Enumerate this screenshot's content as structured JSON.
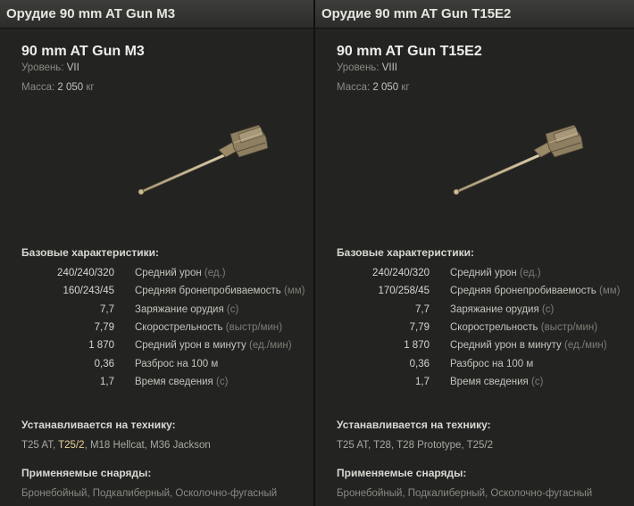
{
  "panels": [
    {
      "header": "Орудие 90 mm AT Gun M3",
      "name": "90 mm AT Gun M3",
      "level_label": "Уровень:",
      "level_value": "VII",
      "mass_label": "Масса:",
      "mass_value": "2 050",
      "mass_unit": "кг",
      "base_title": "Базовые характеристики:",
      "stats": [
        {
          "value": "240/240/320",
          "label": "Средний урон",
          "unit": "(ед.)"
        },
        {
          "value": "160/243/45",
          "label": "Средняя бронепробиваемость",
          "unit": "(мм)"
        },
        {
          "value": "7,7",
          "label": "Заряжание орудия",
          "unit": "(с)"
        },
        {
          "value": "7,79",
          "label": "Скорострельность",
          "unit": "(выстр/мин)"
        },
        {
          "value": "1 870",
          "label": "Средний урон в минуту",
          "unit": "(ед./мин)"
        },
        {
          "value": "0,36",
          "label": "Разброс на 100 м",
          "unit": ""
        },
        {
          "value": "1,7",
          "label": "Время сведения",
          "unit": "(с)"
        }
      ],
      "install_title": "Устанавливается на технику:",
      "vehicles": [
        {
          "name": "T25 AT",
          "highlight": false
        },
        {
          "name": "T25/2",
          "highlight": true
        },
        {
          "name": "M18 Hellcat",
          "highlight": false
        },
        {
          "name": "M36 Jackson",
          "highlight": false
        }
      ],
      "shells_title": "Применяемые снаряды:",
      "shells": "Бронебойный, Подкалиберный, Осколочно-фугасный"
    },
    {
      "header": "Орудие 90 mm AT Gun T15E2",
      "name": "90 mm AT Gun T15E2",
      "level_label": "Уровень:",
      "level_value": "VIII",
      "mass_label": "Масса:",
      "mass_value": "2 050",
      "mass_unit": "кг",
      "base_title": "Базовые характеристики:",
      "stats": [
        {
          "value": "240/240/320",
          "label": "Средний урон",
          "unit": "(ед.)"
        },
        {
          "value": "170/258/45",
          "label": "Средняя бронепробиваемость",
          "unit": "(мм)"
        },
        {
          "value": "7,7",
          "label": "Заряжание орудия",
          "unit": "(с)"
        },
        {
          "value": "7,79",
          "label": "Скорострельность",
          "unit": "(выстр/мин)"
        },
        {
          "value": "1 870",
          "label": "Средний урон в минуту",
          "unit": "(ед./мин)"
        },
        {
          "value": "0,36",
          "label": "Разброс на 100 м",
          "unit": ""
        },
        {
          "value": "1,7",
          "label": "Время сведения",
          "unit": "(с)"
        }
      ],
      "install_title": "Устанавливается на технику:",
      "vehicles": [
        {
          "name": "T25 AT",
          "highlight": false
        },
        {
          "name": "T28",
          "highlight": false
        },
        {
          "name": "T28 Prototype",
          "highlight": false
        },
        {
          "name": "T25/2",
          "highlight": false
        }
      ],
      "shells_title": "Применяемые снаряды:",
      "shells": "Бронебойный, Подкалиберный, Осколочно-фугасный"
    }
  ]
}
